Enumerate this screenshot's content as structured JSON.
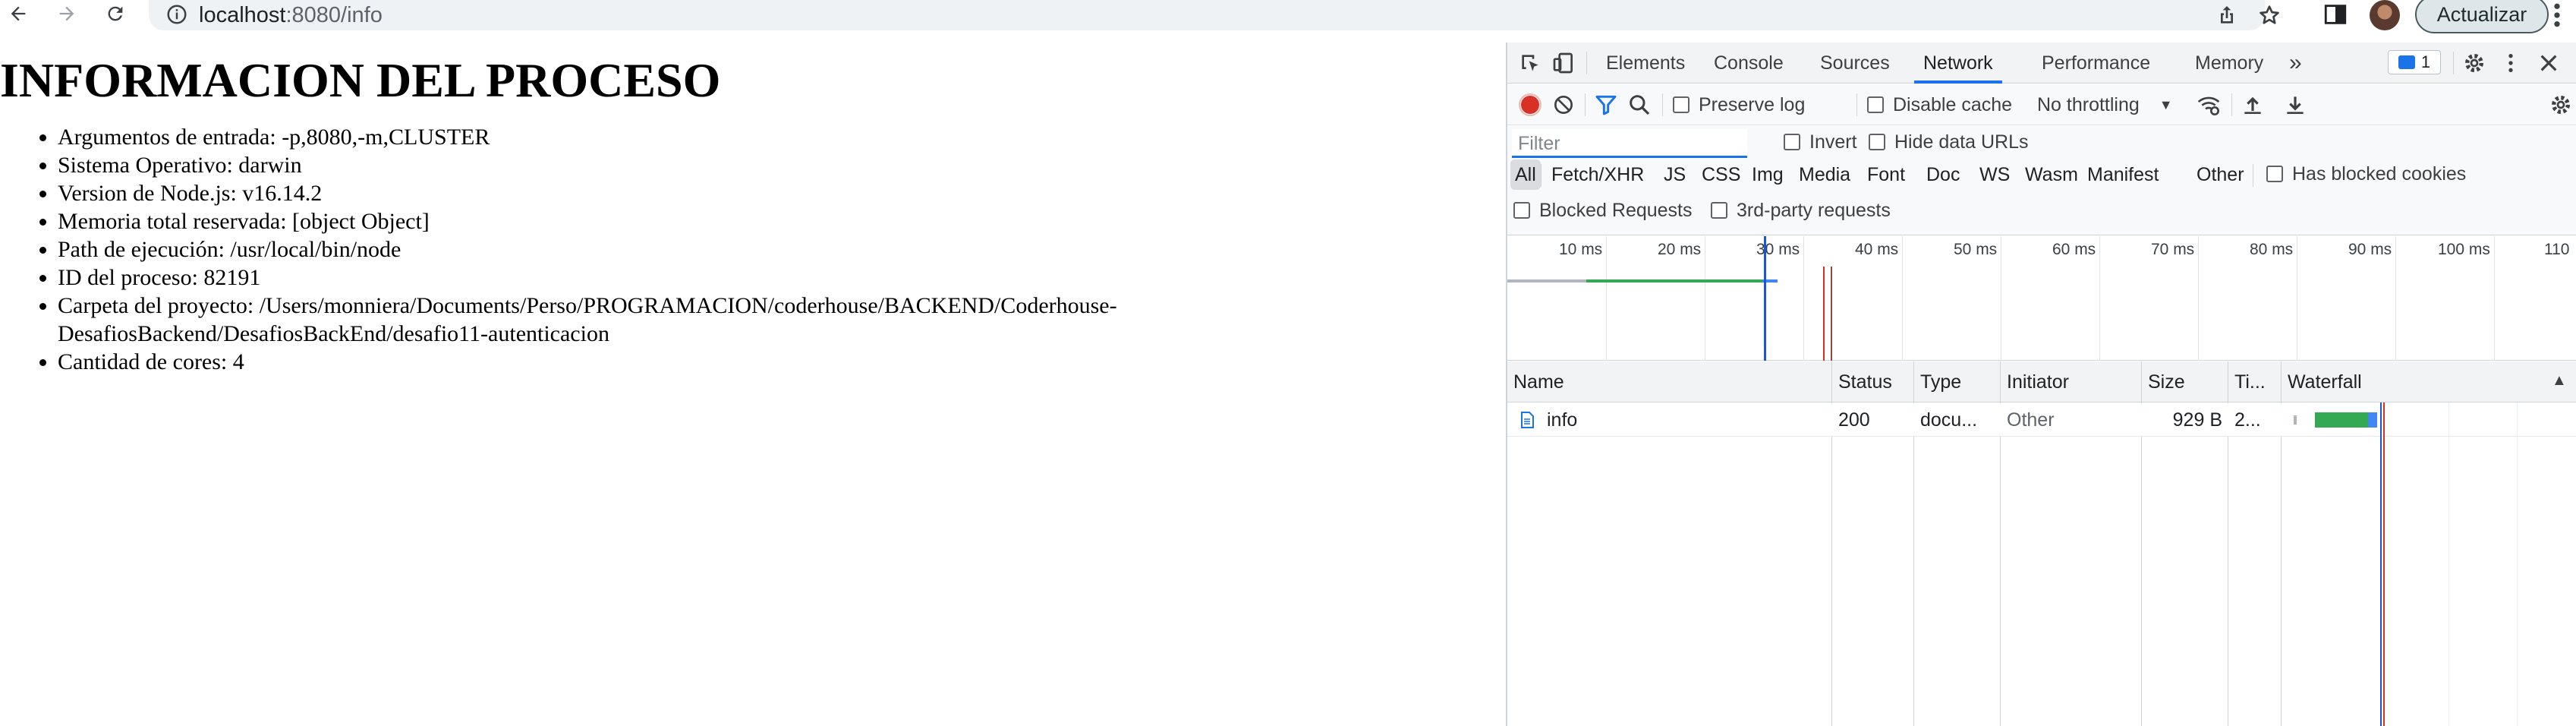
{
  "browser": {
    "url_host": "localhost",
    "url_rest": ":8080/info",
    "update_label": "Actualizar",
    "icons": [
      "back-icon",
      "forward-icon",
      "reload-icon",
      "info-icon",
      "share-icon",
      "star-icon",
      "sidebar-icon",
      "avatar",
      "menu-icon"
    ]
  },
  "page": {
    "title": "INFORMACION DEL PROCESO",
    "items": [
      "Argumentos de entrada: -p,8080,-m,CLUSTER",
      "Sistema Operativo: darwin",
      "Version de Node.js: v16.14.2",
      "Memoria total reservada: [object Object]",
      "Path de ejecución: /usr/local/bin/node",
      "ID del proceso: 82191",
      "Carpeta del proyecto: /Users/monniera/Documents/Perso/PROGRAMACION/coderhouse/BACKEND/Coderhouse-DesafiosBackend/DesafiosBackEnd/desafio11-autenticacion",
      "Cantidad de cores: 4"
    ]
  },
  "devtools": {
    "tabs": [
      "Elements",
      "Console",
      "Sources",
      "Network",
      "Performance",
      "Memory"
    ],
    "active_tab": "Network",
    "more_tabs": "»",
    "issues_count": "1",
    "toolbar": {
      "preserve_log": "Preserve log",
      "disable_cache": "Disable cache",
      "throttling": "No throttling"
    },
    "filter": {
      "placeholder": "Filter",
      "invert": "Invert",
      "hide_data_urls": "Hide data URLs",
      "types": [
        "All",
        "Fetch/XHR",
        "JS",
        "CSS",
        "Img",
        "Media",
        "Font",
        "Doc",
        "WS",
        "Wasm",
        "Manifest",
        "Other"
      ],
      "has_blocked_cookies": "Has blocked cookies",
      "blocked_requests": "Blocked Requests",
      "third_party": "3rd-party requests"
    },
    "timeline_ticks": [
      "10 ms",
      "20 ms",
      "30 ms",
      "40 ms",
      "50 ms",
      "60 ms",
      "70 ms",
      "80 ms",
      "90 ms",
      "100 ms",
      "110"
    ],
    "columns": [
      "Name",
      "Status",
      "Type",
      "Initiator",
      "Size",
      "Ti...",
      "Waterfall"
    ],
    "rows": [
      {
        "name": "info",
        "status": "200",
        "type": "docu...",
        "initiator": "Other",
        "size": "929 B",
        "time": "2..."
      }
    ],
    "colors": {
      "accent": "#1a73e8",
      "record": "#d93025",
      "waterfall_green": "#34a853",
      "waterfall_blue": "#4285f4"
    }
  }
}
